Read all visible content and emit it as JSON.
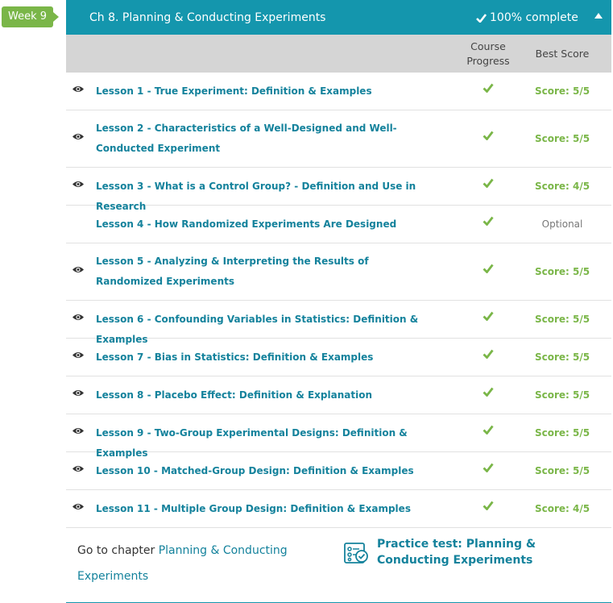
{
  "week": {
    "label": "Week 9"
  },
  "chapter": {
    "title": "Ch 8. Planning & Conducting Experiments",
    "complete": "100% complete"
  },
  "columns": {
    "progress": "Course Progress",
    "best_score": "Best Score"
  },
  "lessons": [
    {
      "title": "Lesson 1 - True Experiment: Definition & Examples",
      "score": "Score: 5/5",
      "has_eye": true
    },
    {
      "title": "Lesson 2 - Characteristics of a Well-Designed and Well-Conducted Experiment",
      "score": "Score: 5/5",
      "has_eye": true
    },
    {
      "title": "Lesson 3 - What is a Control Group? - Definition and Use in Research",
      "score": "Score: 4/5",
      "has_eye": true
    },
    {
      "title": "Lesson 4 - How Randomized Experiments Are Designed",
      "score": "Optional",
      "has_eye": false
    },
    {
      "title": "Lesson 5 - Analyzing & Interpreting the Results of Randomized Experiments",
      "score": "Score: 5/5",
      "has_eye": true
    },
    {
      "title": "Lesson 6 - Confounding Variables in Statistics: Definition & Examples",
      "score": "Score: 5/5",
      "has_eye": true
    },
    {
      "title": "Lesson 7 - Bias in Statistics: Definition & Examples",
      "score": "Score: 5/5",
      "has_eye": true
    },
    {
      "title": "Lesson 8 - Placebo Effect: Definition & Explanation",
      "score": "Score: 5/5",
      "has_eye": true
    },
    {
      "title": "Lesson 9 - Two-Group Experimental Designs: Definition & Examples",
      "score": "Score: 5/5",
      "has_eye": true
    },
    {
      "title": "Lesson 10 - Matched-Group Design: Definition & Examples",
      "score": "Score: 5/5",
      "has_eye": true
    },
    {
      "title": "Lesson 11 - Multiple Group Design: Definition & Examples",
      "score": "Score: 4/5",
      "has_eye": true
    }
  ],
  "footer": {
    "goto_prefix": "Go to chapter",
    "goto_link": "Planning & Conducting Experiments",
    "practice_test": "Practice test: Planning & Conducting Experiments"
  },
  "colors": {
    "accent": "#1496ad",
    "success": "#7ab648",
    "header_gray": "#d5d5d5"
  },
  "icons": {
    "eye": "eye-icon",
    "check": "check-icon",
    "collapse": "caret-up-icon",
    "practice": "practice-test-icon"
  }
}
